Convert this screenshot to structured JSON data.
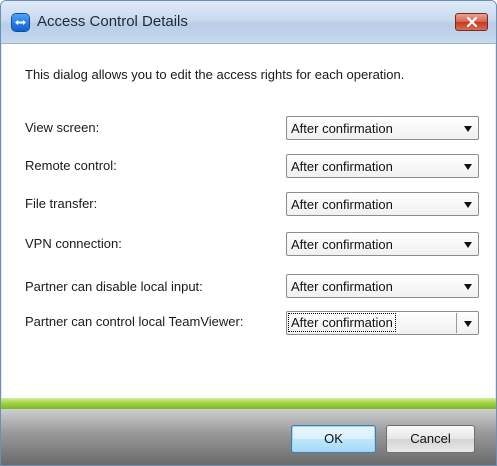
{
  "window": {
    "title": "Access Control Details",
    "close_label": "Close"
  },
  "intro": "This dialog allows you to edit the access rights for each operation.",
  "rows": [
    {
      "label": "View screen:",
      "value": "After confirmation"
    },
    {
      "label": "Remote control:",
      "value": "After confirmation"
    },
    {
      "label": "File transfer:",
      "value": "After confirmation"
    },
    {
      "label": "VPN connection:",
      "value": "After confirmation"
    },
    {
      "label": "Partner can disable local input:",
      "value": "After confirmation"
    },
    {
      "label": "Partner can control local TeamViewer:",
      "value": "After confirmation"
    }
  ],
  "buttons": {
    "ok": "OK",
    "cancel": "Cancel"
  },
  "colors": {
    "accent_green": "#9ed13d",
    "close_red": "#d9614b"
  }
}
